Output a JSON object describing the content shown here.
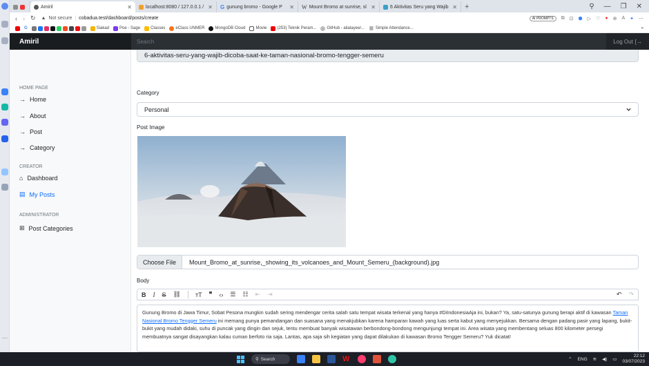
{
  "browser": {
    "tabs": [
      {
        "label": "Amiril",
        "active": true
      },
      {
        "label": "localhost:8080 / 127.0.0.1 /",
        "active": false
      },
      {
        "label": "gunung bromo - Google P",
        "active": false
      },
      {
        "label": "Mount Bromo at sunrise, sl",
        "active": false
      },
      {
        "label": "6 Aktivitas Seru yang Wajib",
        "active": false
      }
    ],
    "not_secure": "Not secure",
    "url": "cobadua.test/dashboard/posts/create",
    "ai_prompts": "AI PROMPTS",
    "bookmarks": [
      "Siakad",
      "Poe - Sage",
      "Classes",
      "eClass UNMER",
      "MongoDB Cloud",
      "Movie",
      "(253) Teknik Peram...",
      "GitHub - aliatayee/...",
      "Simple Attendance..."
    ]
  },
  "navbar": {
    "brand": "Amiril",
    "search_placeholder": "Search",
    "logout": "Log Out"
  },
  "sidebar": {
    "sections": [
      {
        "title": "HOME PAGE",
        "items": [
          "Home",
          "About",
          "Post",
          "Category"
        ]
      },
      {
        "title": "CREATOR",
        "items": [
          "Dashboard",
          "My Posts"
        ]
      },
      {
        "title": "ADMINISTRATOR",
        "items": [
          "Post Categories"
        ]
      }
    ]
  },
  "form": {
    "slug_value": "6-aktivitas-seru-yang-wajib-dicoba-saat-ke-taman-nasional-bromo-tengger-semeru",
    "category_label": "Category",
    "category_value": "Personal",
    "image_label": "Post Image",
    "choose_file": "Choose File",
    "file_name": "Mount_Bromo_at_sunrise,_showing_its_volcanoes_and_Mount_Semeru_(background).jpg",
    "body_label": "Body",
    "body_before_link": "Gunung Bromo di Jawa Timur, Sobat Pesona mungkin sudah sering mendengar cerita salah satu tempat wisata terkenal yang hanya #DiIndonesiaAja ini, bukan? Ya, satu-satunya gunung berapi aktif di kawasan ",
    "body_link": "Taman Nasional Bromo Tengger Semeru",
    "body_after_link": " ini memang punya pemandangan dan suasana yang menakjubkan karena hamparan kawah yang luas serta kabut yang menyejukkan. Bersama dengan padang pasir yang lapang, bukit-bukit yang mudah didaki, suhu di puncak yang dingin dan sejuk, tentu membuat banyak wisatawan berbondong-bondong mengunjungi tempat ini. Area wisata yang membentang seluas 800 kilometer persegi membuatnya sangat disayangkan kalau cuman berfoto ria saja. Lantas, apa saja sih kegiatan yang dapat dilakukan di kawasan Bromo Tengger Semeru? Yuk dicatat!"
  },
  "taskbar": {
    "search": "Search",
    "lang": "ENG",
    "time": "22:12",
    "date": "03/07/2023"
  },
  "colors": {
    "accent": "#0d6efd",
    "navbar": "#212529"
  }
}
